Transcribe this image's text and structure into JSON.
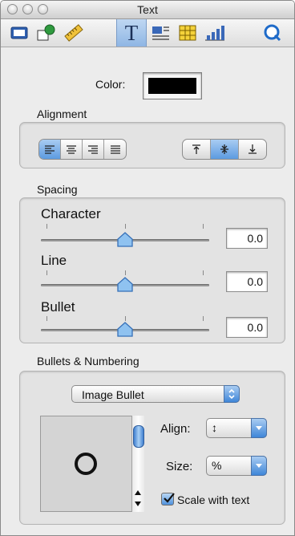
{
  "window": {
    "title": "Text"
  },
  "toolbar": {
    "buttons": [
      {
        "icon": "document-icon"
      },
      {
        "icon": "graphic-icon"
      },
      {
        "icon": "ruler-icon"
      },
      {
        "icon": "text-icon",
        "label": "T",
        "selected": true
      },
      {
        "icon": "wrap-icon"
      },
      {
        "icon": "table-icon"
      },
      {
        "icon": "chart-icon"
      },
      {
        "icon": "quicktime-icon"
      }
    ]
  },
  "color": {
    "label": "Color:",
    "value": "#000000"
  },
  "alignment": {
    "title": "Alignment",
    "horizontal": [
      "align-left-icon",
      "align-center-icon",
      "align-right-icon",
      "align-justify-icon"
    ],
    "horizontal_selected": 0,
    "vertical": [
      "align-top-icon",
      "align-middle-icon",
      "align-bottom-icon"
    ],
    "vertical_selected": 1
  },
  "spacing": {
    "title": "Spacing",
    "rows": [
      {
        "label": "Character",
        "value": "0.0",
        "level": 0.5
      },
      {
        "label": "Line",
        "value": "0.0",
        "level": 0.5
      },
      {
        "label": "Bullet",
        "value": "0.0",
        "level": 0.5
      }
    ]
  },
  "bullets": {
    "title": "Bullets & Numbering",
    "type": "Image Bullet",
    "align_label": "Align:",
    "align_value": "↕",
    "size_label": "Size:",
    "size_value": "%",
    "scale_label": "Scale with text",
    "scale_checked": true
  }
}
